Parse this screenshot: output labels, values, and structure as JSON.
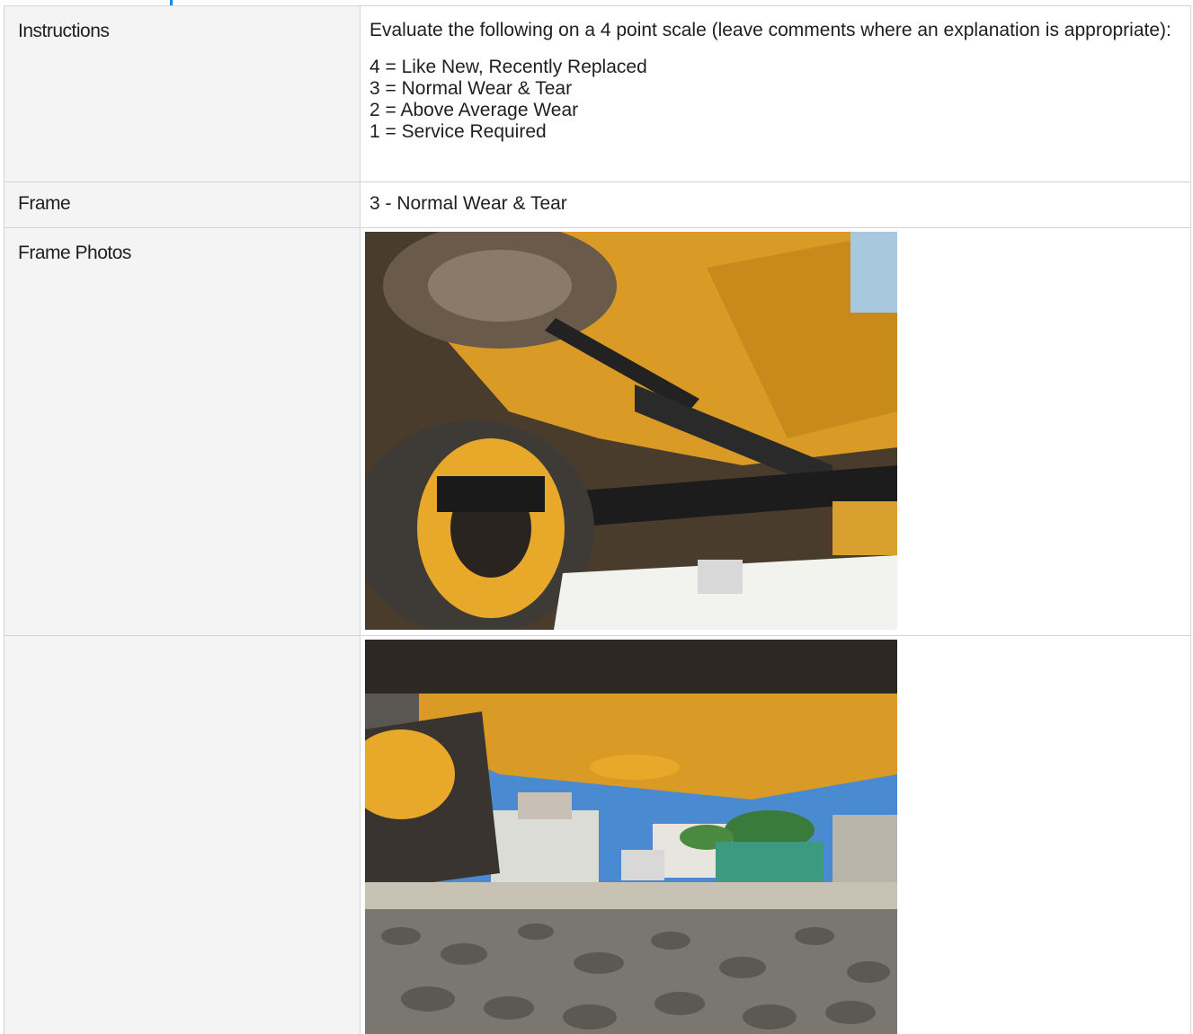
{
  "rows": {
    "instructions": {
      "label": "Instructions",
      "intro": "Evaluate the following on a 4 point scale (leave comments where an explanation is appropriate):",
      "scale": [
        "4 = Like New, Recently Replaced",
        "3 = Normal Wear & Tear",
        "2 = Above Average Wear",
        "1 = Service Required"
      ]
    },
    "frame": {
      "label": "Frame",
      "value": "3 - Normal Wear & Tear"
    },
    "frame_photos": {
      "label": "Frame Photos",
      "second_row_label": ""
    }
  },
  "colors": {
    "accent": "#1e88e5",
    "label_bg": "#f4f4f4",
    "border": "#d4d4d4",
    "equipment_yellow": "#e8a92a"
  }
}
